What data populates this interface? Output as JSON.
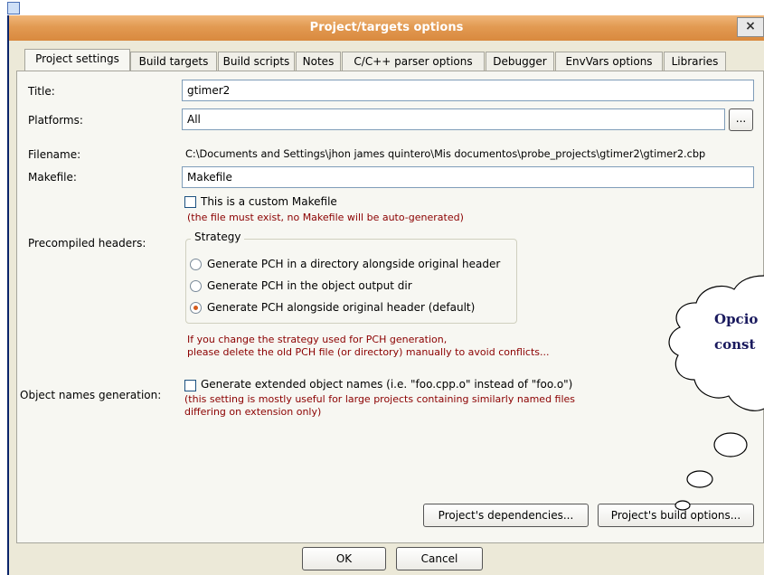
{
  "window": {
    "title": "Project/targets options",
    "close_label": "×"
  },
  "tabs": [
    {
      "label": "Project settings",
      "active": true
    },
    {
      "label": "Build targets"
    },
    {
      "label": "Build scripts"
    },
    {
      "label": "Notes"
    },
    {
      "label": "C/C++ parser options"
    },
    {
      "label": "Debugger"
    },
    {
      "label": "EnvVars options"
    },
    {
      "label": "Libraries"
    }
  ],
  "form": {
    "title_label": "Title:",
    "title_value": "gtimer2",
    "platforms_label": "Platforms:",
    "platforms_value": "All",
    "platforms_browse": "...",
    "filename_label": "Filename:",
    "filename_value": "C:\\Documents and Settings\\jhon james quintero\\Mis documentos\\probe_projects\\gtimer2\\gtimer2.cbp",
    "makefile_label": "Makefile:",
    "makefile_value": "Makefile",
    "custom_makefile_label": "This is a custom Makefile",
    "custom_makefile_note": "(the file must exist, no Makefile will be auto-generated)",
    "pch_label": "Precompiled headers:",
    "strategy_title": "Strategy",
    "strategy_options": [
      "Generate PCH in a directory alongside original header",
      "Generate PCH in the object output dir",
      "Generate PCH alongside original header (default)"
    ],
    "strategy_selected_index": 2,
    "pch_warning_1": "If you change the strategy used for PCH generation,",
    "pch_warning_2": "please delete the old PCH file (or directory) manually to avoid conflicts...",
    "objnames_label": "Object names generation:",
    "objnames_checkbox_label": "Generate extended object names (i.e. \"foo.cpp.o\" instead of \"foo.o\")",
    "objnames_note_1": "(this setting is mostly useful for large projects containing similarly named files",
    "objnames_note_2": "differing on extension only)"
  },
  "buttons": {
    "dependencies": "Project's dependencies...",
    "build_options": "Project's build options...",
    "ok": "OK",
    "cancel": "Cancel"
  },
  "callout": {
    "line1": "Opcio",
    "line2": "const"
  },
  "colors": {
    "titlebar": "#e29a52",
    "warning_text": "#8b0000",
    "radio_selected": "#d45a1b"
  }
}
